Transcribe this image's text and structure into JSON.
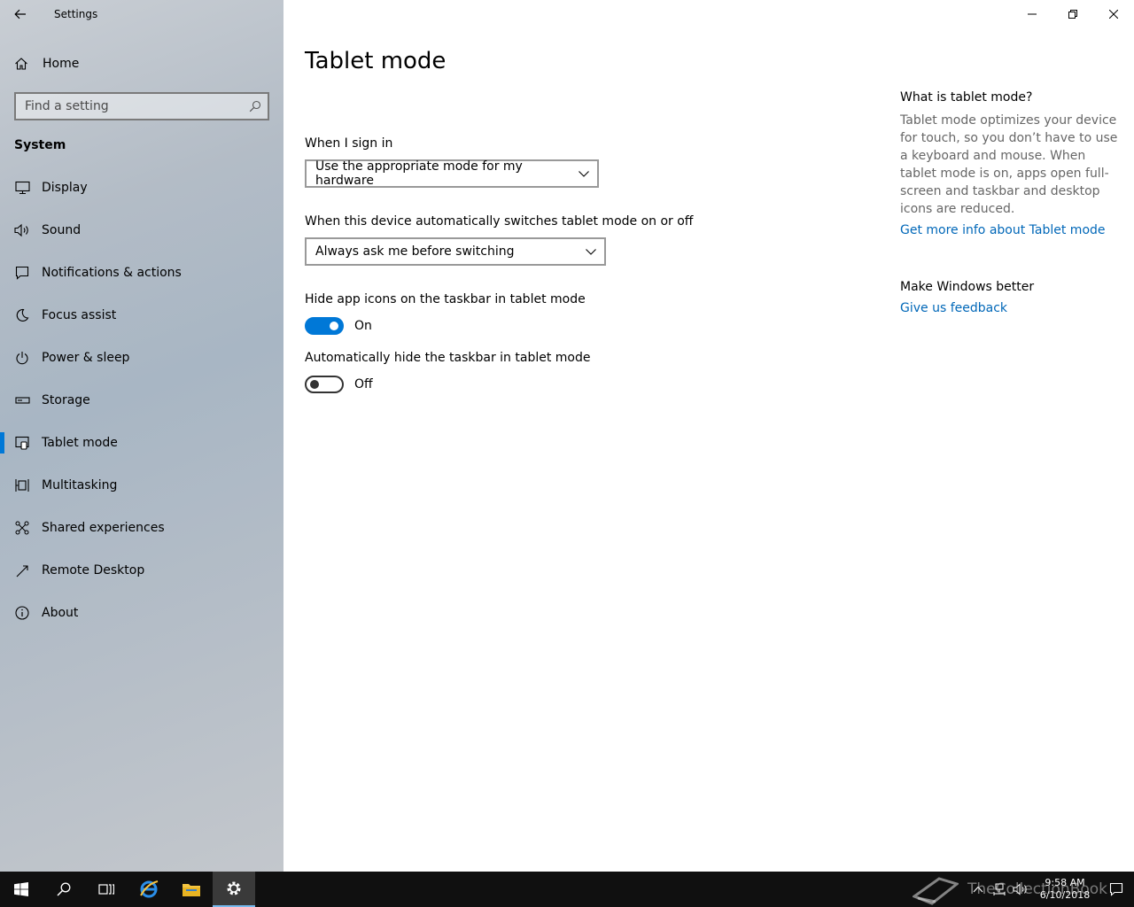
{
  "window": {
    "app_title": "Settings"
  },
  "sidebar": {
    "home_label": "Home",
    "search": {
      "placeholder": "Find a setting"
    },
    "group_title": "System",
    "items": [
      {
        "label": "Display",
        "icon": "monitor-icon"
      },
      {
        "label": "Sound",
        "icon": "speaker-icon"
      },
      {
        "label": "Notifications & actions",
        "icon": "message-icon"
      },
      {
        "label": "Focus assist",
        "icon": "moon-icon"
      },
      {
        "label": "Power & sleep",
        "icon": "power-icon"
      },
      {
        "label": "Storage",
        "icon": "drive-icon"
      },
      {
        "label": "Tablet mode",
        "icon": "tablet-icon",
        "selected": true
      },
      {
        "label": "Multitasking",
        "icon": "multitask-icon"
      },
      {
        "label": "Shared experiences",
        "icon": "share-icon"
      },
      {
        "label": "Remote Desktop",
        "icon": "remote-icon"
      },
      {
        "label": "About",
        "icon": "info-icon"
      }
    ]
  },
  "main": {
    "title": "Tablet mode",
    "sign_in": {
      "label": "When I sign in",
      "value": "Use the appropriate mode for my hardware"
    },
    "auto_switch": {
      "label": "When this device automatically switches tablet mode on or off",
      "value": "Always ask me before switching"
    },
    "hide_icons": {
      "label": "Hide app icons on the taskbar in tablet mode",
      "state": "On"
    },
    "hide_taskbar": {
      "label": "Automatically hide the taskbar in tablet mode",
      "state": "Off"
    }
  },
  "side_panel": {
    "heading1": "What is tablet mode?",
    "description": "Tablet mode optimizes your device for touch, so you don’t have to use a keyboard and mouse. When tablet mode is on, apps open full-screen and taskbar and desktop icons are reduced.",
    "link1": "Get more info about Tablet mode",
    "heading2": "Make Windows better",
    "link2": "Give us feedback"
  },
  "taskbar": {
    "time": "9:58 AM",
    "date": "6/10/2018",
    "watermark": "TheCollectionBook"
  },
  "colors": {
    "accent": "#0078d7",
    "link": "#0067b8",
    "taskbar": "#101010"
  }
}
